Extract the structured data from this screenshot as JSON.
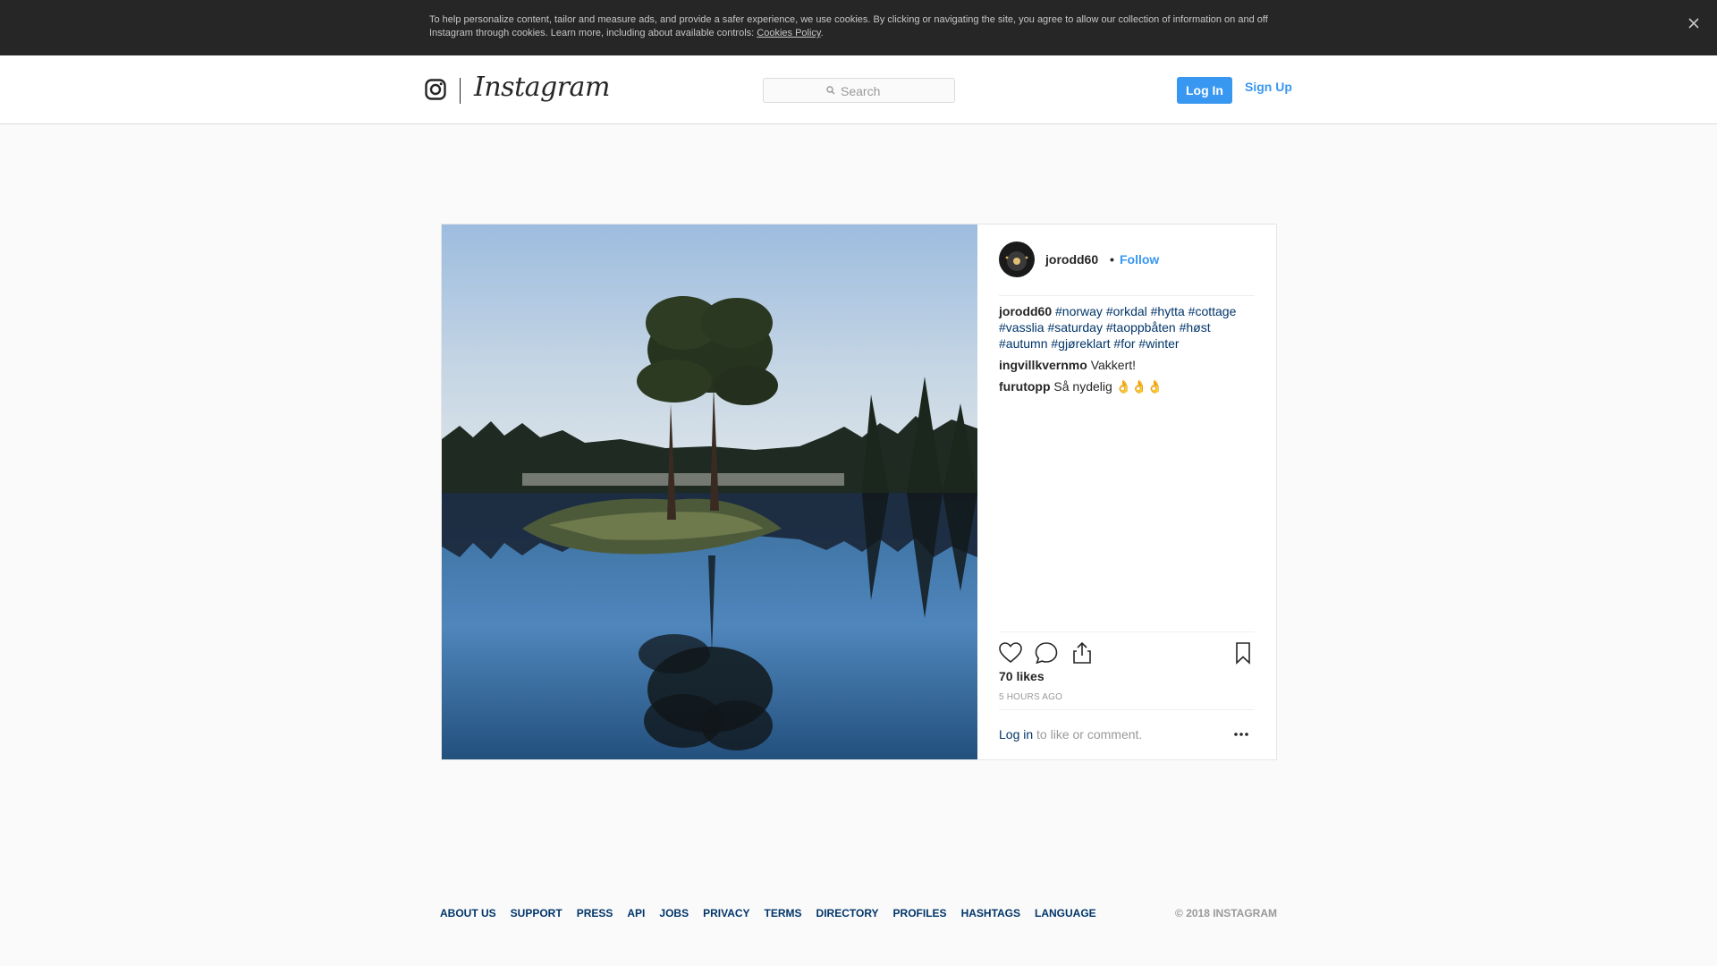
{
  "cookie_banner": {
    "text": "To help personalize content, tailor and measure ads, and provide a safer experience, we use cookies. By clicking or navigating the site, you agree to allow our collection of information on and off Instagram through cookies. Learn more, including about available controls: ",
    "link": "Cookies Policy",
    "after_link": ".",
    "close_icon": "close-icon"
  },
  "header": {
    "wordmark": "Instagram",
    "logo_icon": "instagram-glyph-icon",
    "search_placeholder": "Search",
    "search_icon": "search-icon",
    "login_label": "Log In",
    "signup_label": "Sign Up"
  },
  "post": {
    "username": "jorodd60",
    "dot": "•",
    "follow_label": "Follow",
    "comments": [
      {
        "user": "jorodd60",
        "tags": [
          "#norway",
          "#orkdal",
          "#hytta",
          "#cottage",
          "#vasslia",
          "#saturday",
          "#taoppbåten",
          "#høst",
          "#autumn",
          "#gjøreklart",
          "#for",
          "#winter"
        ]
      },
      {
        "user": "ingvillkvernmo",
        "text": "Vakkert!"
      },
      {
        "user": "furutopp",
        "text": "Så nydelig 👌👌👌"
      }
    ],
    "likes": "70 likes",
    "time": "5 HOURS AGO",
    "login_link": "Log in",
    "login_text": " to like or comment.",
    "icons": [
      "heart-icon",
      "comment-icon",
      "share-icon",
      "bookmark-icon",
      "more-options-icon"
    ]
  },
  "footer": {
    "links": [
      "ABOUT US",
      "SUPPORT",
      "PRESS",
      "API",
      "JOBS",
      "PRIVACY",
      "TERMS",
      "DIRECTORY",
      "PROFILES",
      "HASHTAGS",
      "LANGUAGE"
    ],
    "copyright": "© 2018 INSTAGRAM"
  },
  "colors": {
    "accent": "#3897f0",
    "link": "#003569",
    "banner": "#262626"
  }
}
